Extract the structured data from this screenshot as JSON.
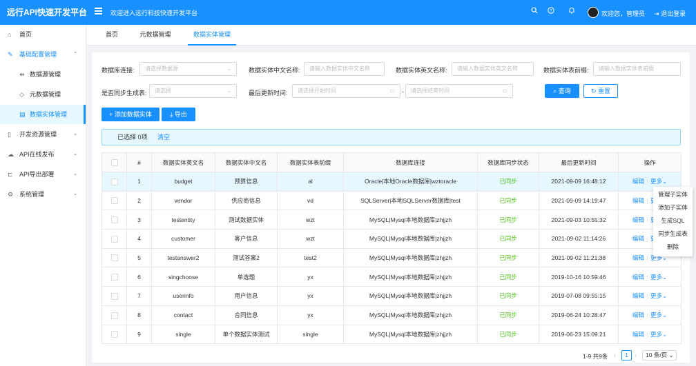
{
  "app": {
    "title": "远行API快速开发平台",
    "welcome": "欢迎进入远行科技快速开发平台",
    "user_greeting": "欢迎您，管理员",
    "logout": "退出登录"
  },
  "sidebar": {
    "items": [
      {
        "label": "首页",
        "icon": "home-icon"
      },
      {
        "label": "基础配置管理",
        "icon": "wrench-icon"
      },
      {
        "label": "数据源管理",
        "icon": "datasource-icon"
      },
      {
        "label": "元数据管理",
        "icon": "tag-icon"
      },
      {
        "label": "数据实体管理",
        "icon": "table-icon"
      },
      {
        "label": "开发资源管理",
        "icon": "file-icon"
      },
      {
        "label": "API在线发布",
        "icon": "cloud-icon"
      },
      {
        "label": "API导出部署",
        "icon": "export-icon"
      },
      {
        "label": "系统管理",
        "icon": "gear-icon"
      }
    ]
  },
  "tabs": [
    "首页",
    "元数据管理",
    "数据实体管理"
  ],
  "filters": {
    "db_conn_label": "数据库连接:",
    "db_conn_placeholder": "请选择数据源",
    "cn_name_label": "数据实体中文名称:",
    "cn_name_placeholder": "请输入数据实体中文名称",
    "en_name_label": "数据实体英文名称:",
    "en_name_placeholder": "请输入数据实体英文名称",
    "prefix_label": "数据实体表前缀:",
    "prefix_placeholder": "请输入数据实体表前缀",
    "sync_label": "是否同步生成表:",
    "sync_placeholder": "请选择",
    "time_label": "最后更新时间:",
    "start_placeholder": "请选择开始时间",
    "range_sep": "-",
    "end_placeholder": "请选择结束时间",
    "search_btn": "查询",
    "reset_btn": "重置"
  },
  "actions": {
    "add_btn": "添加数据实体",
    "export_btn": "导出"
  },
  "selection": {
    "selected_text": "已选择 0项",
    "clear_text": "清空"
  },
  "table": {
    "headers": [
      "",
      "#",
      "数据实体英文名",
      "数据实体中文名",
      "数据实体表前缀",
      "数据库连接",
      "数据库同步状态",
      "最后更新时间",
      "操作"
    ],
    "rows": [
      {
        "no": "1",
        "en": "budget",
        "cn": "预算信息",
        "prefix": "al",
        "conn": "Oracle|本地Oracle数据库|wztoracle",
        "status": "已同步",
        "time": "2021-09-09 16:48:12"
      },
      {
        "no": "2",
        "en": "vendor",
        "cn": "供应商信息",
        "prefix": "vd",
        "conn": "SQLServer|本地SQLServer数据库|test",
        "status": "已同步",
        "time": "2021-09-09 14:19:47"
      },
      {
        "no": "3",
        "en": "testentity",
        "cn": "测试数据实体",
        "prefix": "wzt",
        "conn": "MySQL|Mysql本地数据库|zhjjzh",
        "status": "已同步",
        "time": "2021-09-03 10:55:32"
      },
      {
        "no": "4",
        "en": "customer",
        "cn": "客户信息",
        "prefix": "wzt",
        "conn": "MySQL|Mysql本地数据库|zhjjzh",
        "status": "已同步",
        "time": "2021-09-02 11:14:26"
      },
      {
        "no": "5",
        "en": "testanswer2",
        "cn": "测试答案2",
        "prefix": "test2",
        "conn": "MySQL|Mysql本地数据库|zhjjzh",
        "status": "已同步",
        "time": "2021-09-02 11:21:38"
      },
      {
        "no": "6",
        "en": "singchoose",
        "cn": "单选题",
        "prefix": "yx",
        "conn": "MySQL|Mysql本地数据库|zhjjzh",
        "status": "已同步",
        "time": "2019-10-16 10:59:46"
      },
      {
        "no": "7",
        "en": "userinfo",
        "cn": "用户信息",
        "prefix": "yx",
        "conn": "MySQL|Mysql本地数据库|zhjjzh",
        "status": "已同步",
        "time": "2019-07-08 09:55:15"
      },
      {
        "no": "8",
        "en": "contact",
        "cn": "合同信息",
        "prefix": "yx",
        "conn": "MySQL|Mysql本地数据库|zhjjzh",
        "status": "已同步",
        "time": "2019-06-24 10:28:47"
      },
      {
        "no": "9",
        "en": "single",
        "cn": "单个数据实体测试",
        "prefix": "single",
        "conn": "MySQL|Mysql本地数据库|zhjjzh",
        "status": "已同步",
        "time": "2019-06-23 15:09:21"
      }
    ],
    "edit_label": "编辑",
    "more_label": "更多"
  },
  "more_menu": [
    "管理子实体",
    "添加子实体",
    "生成SQL",
    "同步生成表",
    "删除"
  ],
  "pagination": {
    "info": "1-9 共9条",
    "current_page": "1",
    "page_size": "10 条/页"
  },
  "colors": {
    "primary": "#1890ff",
    "success": "#52c41a",
    "highlight_row": "#e6f7ff"
  }
}
